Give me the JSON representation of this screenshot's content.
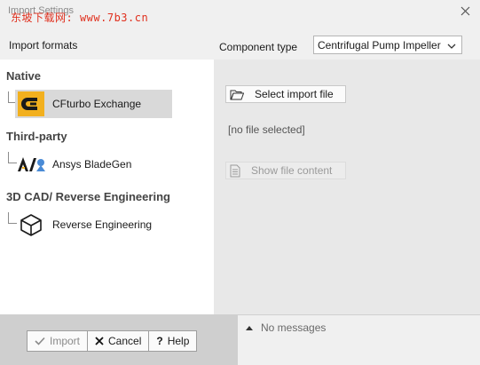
{
  "window": {
    "title": "Import Settings",
    "watermark": "东坡下载网: www.7b3.cn"
  },
  "left": {
    "heading": "Import formats",
    "categories": [
      {
        "label": "Native",
        "items": [
          {
            "label": "CFturbo Exchange",
            "icon": "cfturbo-logo-icon"
          }
        ]
      },
      {
        "label": "Third-party",
        "items": [
          {
            "label": "Ansys BladeGen",
            "icon": "ansys-logo-icon"
          }
        ]
      },
      {
        "label": "3D CAD/ Reverse Engineering",
        "items": [
          {
            "label": "Reverse Engineering",
            "icon": "cube-icon"
          }
        ]
      }
    ]
  },
  "component": {
    "label": "Component type",
    "selected": "Centrifugal Pump Impeller"
  },
  "actions": {
    "select_file": "Select import file",
    "file_status": "[no file selected]",
    "show_content": "Show file content"
  },
  "footer": {
    "import": "Import",
    "cancel": "Cancel",
    "help": "Help",
    "messages": "No messages"
  },
  "colors": {
    "accent_yellow": "#f2b01e",
    "selected_bg": "#d9d9d9",
    "panel_right": "#e8e8e8"
  }
}
